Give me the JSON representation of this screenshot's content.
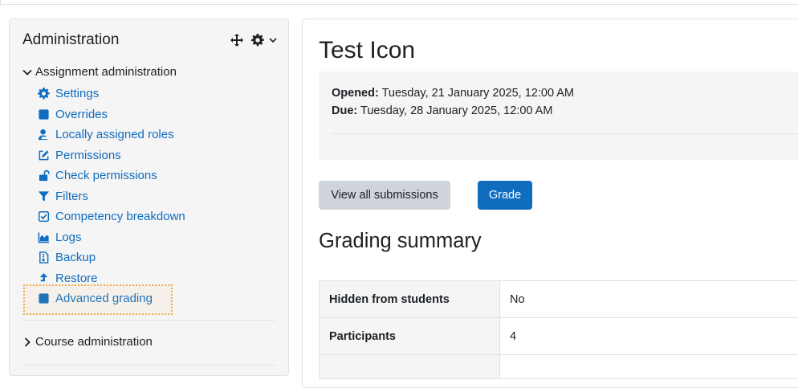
{
  "colors": {
    "link": "#0f6cbf",
    "primary": "#0f6cbf",
    "focus_outline": "#f0ad4e",
    "panel_bg": "#f5f5f5"
  },
  "sidebar": {
    "title": "Administration",
    "actions": [
      {
        "icon": "move-icon"
      },
      {
        "icon": "gear-icon"
      },
      {
        "icon": "chevron-down-icon"
      }
    ],
    "assignment_admin": {
      "label": "Assignment administration",
      "expanded": true,
      "items": [
        {
          "label": "Settings",
          "icon": "gear-icon"
        },
        {
          "label": "Overrides",
          "icon": "square-icon"
        },
        {
          "label": "Locally assigned roles",
          "icon": "user-tag-icon"
        },
        {
          "label": "Permissions",
          "icon": "pencil-square-icon"
        },
        {
          "label": "Check permissions",
          "icon": "unlock-icon"
        },
        {
          "label": "Filters",
          "icon": "filter-icon"
        },
        {
          "label": "Competency breakdown",
          "icon": "check-square-icon"
        },
        {
          "label": "Logs",
          "icon": "chart-area-icon"
        },
        {
          "label": "Backup",
          "icon": "file-zip-icon"
        },
        {
          "label": "Restore",
          "icon": "arrow-up-icon"
        },
        {
          "label": "Advanced grading",
          "icon": "square-icon",
          "focused": true
        }
      ]
    },
    "course_admin": {
      "label": "Course administration",
      "expanded": false
    }
  },
  "main": {
    "title": "Test Icon",
    "dates": {
      "opened_label": "Opened:",
      "opened_value": "Tuesday, 21 January 2025, 12:00 AM",
      "due_label": "Due:",
      "due_value": "Tuesday, 28 January 2025, 12:00 AM"
    },
    "buttons": {
      "view_all": "View all submissions",
      "grade": "Grade"
    },
    "summary_title": "Grading summary",
    "summary_rows": [
      {
        "label": "Hidden from students",
        "value": "No"
      },
      {
        "label": "Participants",
        "value": "4"
      }
    ]
  }
}
